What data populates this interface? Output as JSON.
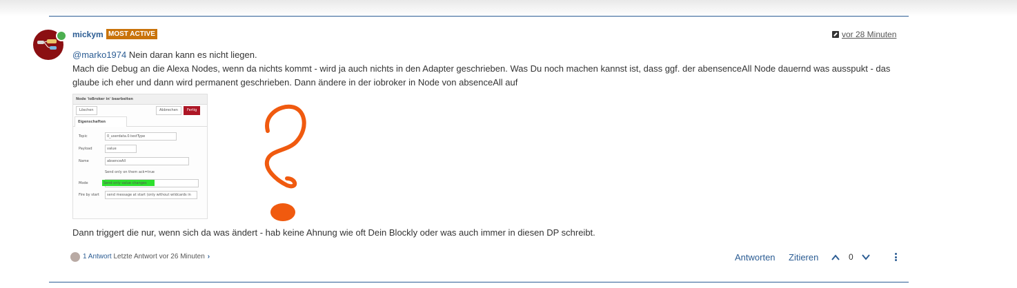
{
  "post": {
    "author": "mickym",
    "badge": "MOST ACTIVE",
    "timestamp": "vor 28 Minuten",
    "mention": "@marko1974",
    "line1_rest": " Nein daran kann es nicht liegen.",
    "paragraph": "Mach die Debug an die Alexa Nodes, wenn da nichts kommt - wird ja auch nichts in den Adapter geschrieben. Was Du noch machen kannst ist, dass ggf. der abensenceAll Node dauernd was ausspukt - das glaube ich eher und dann wird permanent geschrieben. Dann ändere in der iobroker in Node von absenceAll auf",
    "closing": "Dann triggert die nur, wenn sich da was ändert - hab keine Ahnung wie oft Dein Blockly oder was auch immer in diesen DP schreibt."
  },
  "screenshot": {
    "title": "Node 'ioBroker in' bearbeiten",
    "delete_btn": "Löschen",
    "cancel_btn": "Abbrechen",
    "done_btn": "Fertig",
    "tab": "Eigenschaften",
    "topic_label": "Topic",
    "topic_value": "0_userdata.0.testType",
    "payload_label": "Payload",
    "payload_value": "value",
    "name_label": "Name",
    "name_value": "absenceAll",
    "checkbox_label": "Send only on them ack=true",
    "mode_label": "Mode",
    "mode_value": "Send only value changes",
    "fire_label": "Fire by start",
    "fire_value": "send message at start (only without wildcards in"
  },
  "footer": {
    "reply_count": "1 Antwort",
    "last_reply": "Letzte Antwort vor 26 Minuten",
    "reply_btn": "Antworten",
    "quote_btn": "Zitieren",
    "votes": "0"
  },
  "colors": {
    "link": "#2b5c93",
    "badge": "#c9730a",
    "doodle": "#f05a0f",
    "avatar": "#8b0f12"
  },
  "icons": {
    "edit": "edit-icon",
    "upvote": "chevron-up-icon",
    "downvote": "chevron-down-icon",
    "menu": "vertical-dots-icon"
  }
}
